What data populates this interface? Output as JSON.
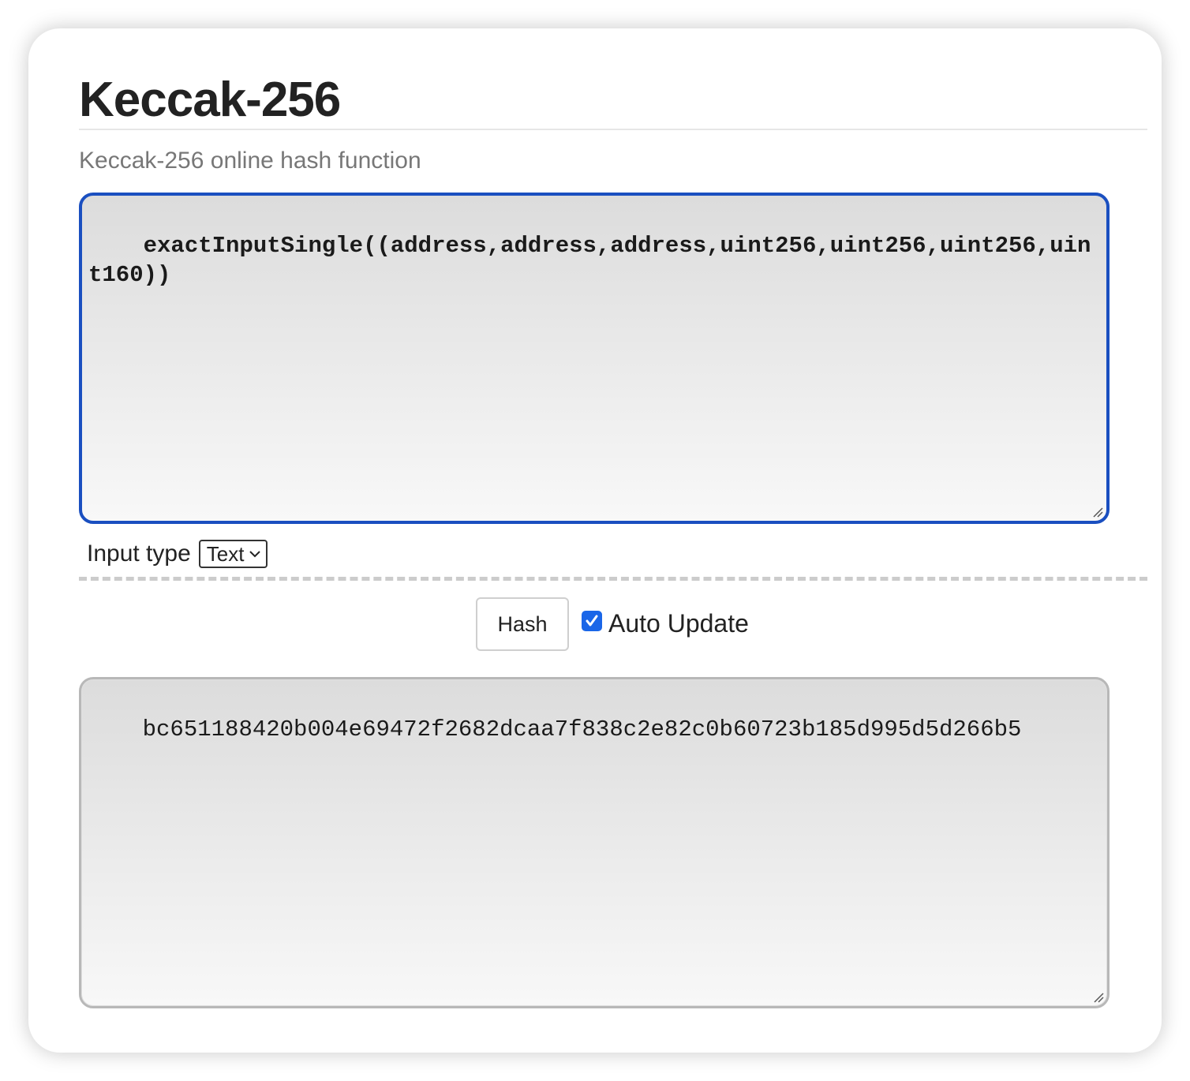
{
  "header": {
    "title": "Keccak-256",
    "subtitle": "Keccak-256 online hash function"
  },
  "input": {
    "value": "exactInputSingle((address,address,address,uint256,uint256,uint256,uint160))"
  },
  "input_type": {
    "label": "Input type",
    "selected": "Text"
  },
  "controls": {
    "hash_label": "Hash",
    "auto_update_label": "Auto Update",
    "auto_update_checked": true
  },
  "output": {
    "value": "bc651188420b004e69472f2682dcaa7f838c2e82c0b60723b185d995d5d266b5"
  },
  "colors": {
    "focus_border": "#1a4fc0",
    "checkbox": "#1a66e8"
  }
}
